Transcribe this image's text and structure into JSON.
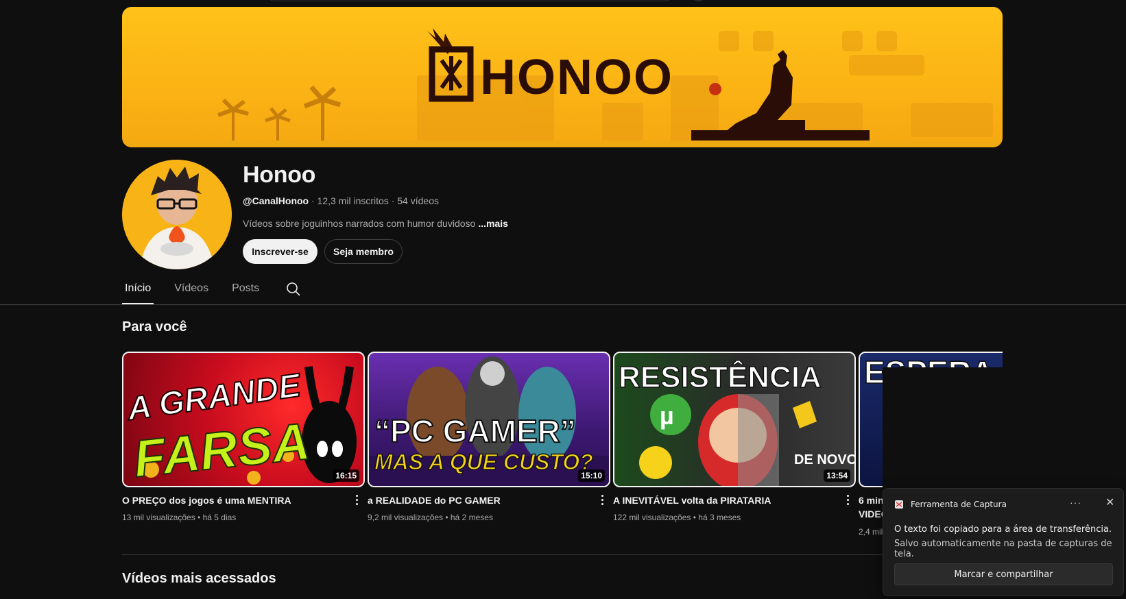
{
  "banner": {
    "logo_text": "HONOO",
    "logo_kanji": "炎"
  },
  "channel": {
    "name": "Honoo",
    "handle": "@CanalHonoo",
    "subscribers": "12,3 mil inscritos",
    "videos_count": "54 vídeos",
    "separator": " · ",
    "description": "Vídeos sobre joguinhos narrados com humor duvidoso",
    "more_label": "...mais"
  },
  "actions": {
    "subscribe_label": "Inscrever-se",
    "member_label": "Seja membro"
  },
  "tabs": [
    {
      "label": "Início",
      "active": true
    },
    {
      "label": "Vídeos",
      "active": false
    },
    {
      "label": "Posts",
      "active": false
    }
  ],
  "sections": {
    "for_you": "Para você",
    "most_viewed": "Vídeos mais acessados"
  },
  "videos": [
    {
      "title": "O PREÇO dos jogos é uma MENTIRA",
      "views": "13 mil visualizações",
      "age": "há 5 dias",
      "duration": "16:15",
      "thumb_text_1": "A GRANDE",
      "thumb_text_2": "FARSA"
    },
    {
      "title": "a REALIDADE do PC GAMER",
      "views": "9,2 mil visualizações",
      "age": "há 2 meses",
      "duration": "15:10",
      "thumb_text_1": "“PC GAMER”",
      "thumb_text_2": "MAS A QUE CUSTO?"
    },
    {
      "title": "A INEVITÁVEL volta da PIRATARIA",
      "views": "122 mil visualizações",
      "age": "há 3 meses",
      "duration": "13:54",
      "thumb_text_1": "RESISTÊNCIA",
      "thumb_text_2": "DE NOVO"
    },
    {
      "title": "6 min",
      "title_line2": "VIDEO",
      "views": "2,4 mil",
      "age": "",
      "duration": "",
      "thumb_text_1": "ESPERA",
      "thumb_text_2": ""
    }
  ],
  "toast": {
    "app_name": "Ferramenta de Captura",
    "more": "···",
    "close": "✕",
    "line1": "O texto foi copiado para a área de transferência.",
    "line2": "Salvo automaticamente na pasta de capturas de tela.",
    "button_label": "Marcar e compartilhar"
  },
  "colors": {
    "background": "#0f0f0f",
    "banner_yellow": "#ffc21a",
    "text_primary": "#f1f1f1",
    "text_secondary": "#aaaaaa"
  }
}
